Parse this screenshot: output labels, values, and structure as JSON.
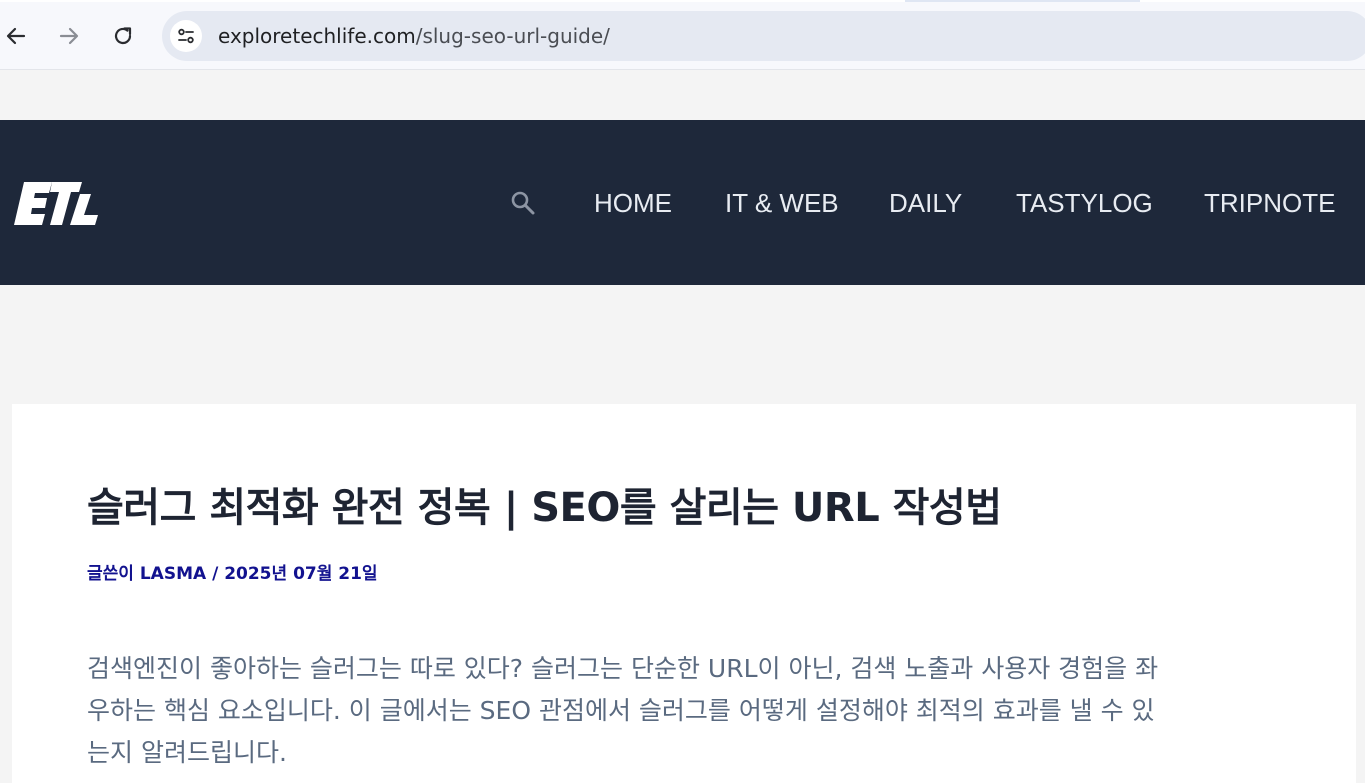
{
  "browser": {
    "url_domain": "exploretechlife.com",
    "url_path": "/slug-seo-url-guide/"
  },
  "site": {
    "logo_text": "ETL",
    "nav": [
      {
        "label": "HOME"
      },
      {
        "label": "IT & WEB"
      },
      {
        "label": "DAILY"
      },
      {
        "label": "TASTYLOG"
      },
      {
        "label": "TRIPNOTE"
      }
    ]
  },
  "article": {
    "title": "슬러그 최적화 완전 정복 | SEO를 살리는 URL 작성법",
    "meta": "글쓴이 LASMA / 2025년 07월 21일",
    "excerpt_lines": [
      "검색엔진이 좋아하는 슬러그는 따로 있다? 슬러그는 단순한 URL이 아닌, 검색 노출과 사용자 경험을 좌",
      "우하는 핵심 요소입니다. 이 글에서는 SEO 관점에서 슬러그를 어떻게 설정해야 최적의 효과를 낼 수 있",
      "는지 알려드립니다."
    ]
  },
  "colors": {
    "header_bg": "#1e283a",
    "meta_link": "#12128f",
    "excerpt_text": "#5a6a80"
  }
}
